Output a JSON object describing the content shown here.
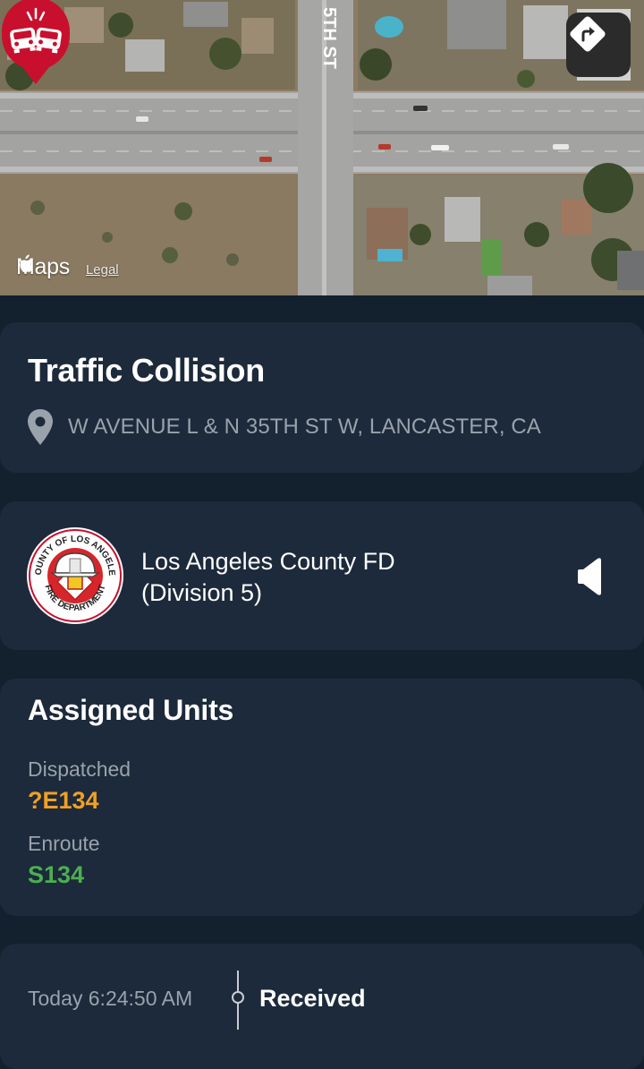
{
  "map": {
    "brand": "Maps",
    "legal_link": "Legal",
    "street_label": "5TH ST",
    "marker_icon": "car-collision-icon",
    "directions_icon": "directions-arrow-icon"
  },
  "incident": {
    "title": "Traffic Collision",
    "location": "W AVENUE L & N 35TH ST W, LANCASTER, CA",
    "location_icon": "location-pin-icon"
  },
  "agency": {
    "name_line1": "Los Angeles County FD",
    "name_line2": "(Division 5)",
    "logo": {
      "top_text": "COUNTY OF LOS ANGELES",
      "bottom_text": "FIRE DEPARTMENT"
    },
    "audio_icon": "speaker-icon"
  },
  "units": {
    "title": "Assigned Units",
    "groups": [
      {
        "status": "Dispatched",
        "unit": "?E134",
        "color": "#f1a024"
      },
      {
        "status": "Enroute",
        "unit": "S134",
        "color": "#4caf50"
      }
    ]
  },
  "timeline": {
    "time": "Today 6:24:50 AM",
    "event": "Received"
  },
  "colors": {
    "background": "#13202e",
    "card": "#1c2a3b",
    "marker": "#c8102e",
    "muted_text": "#9aa2ab"
  }
}
